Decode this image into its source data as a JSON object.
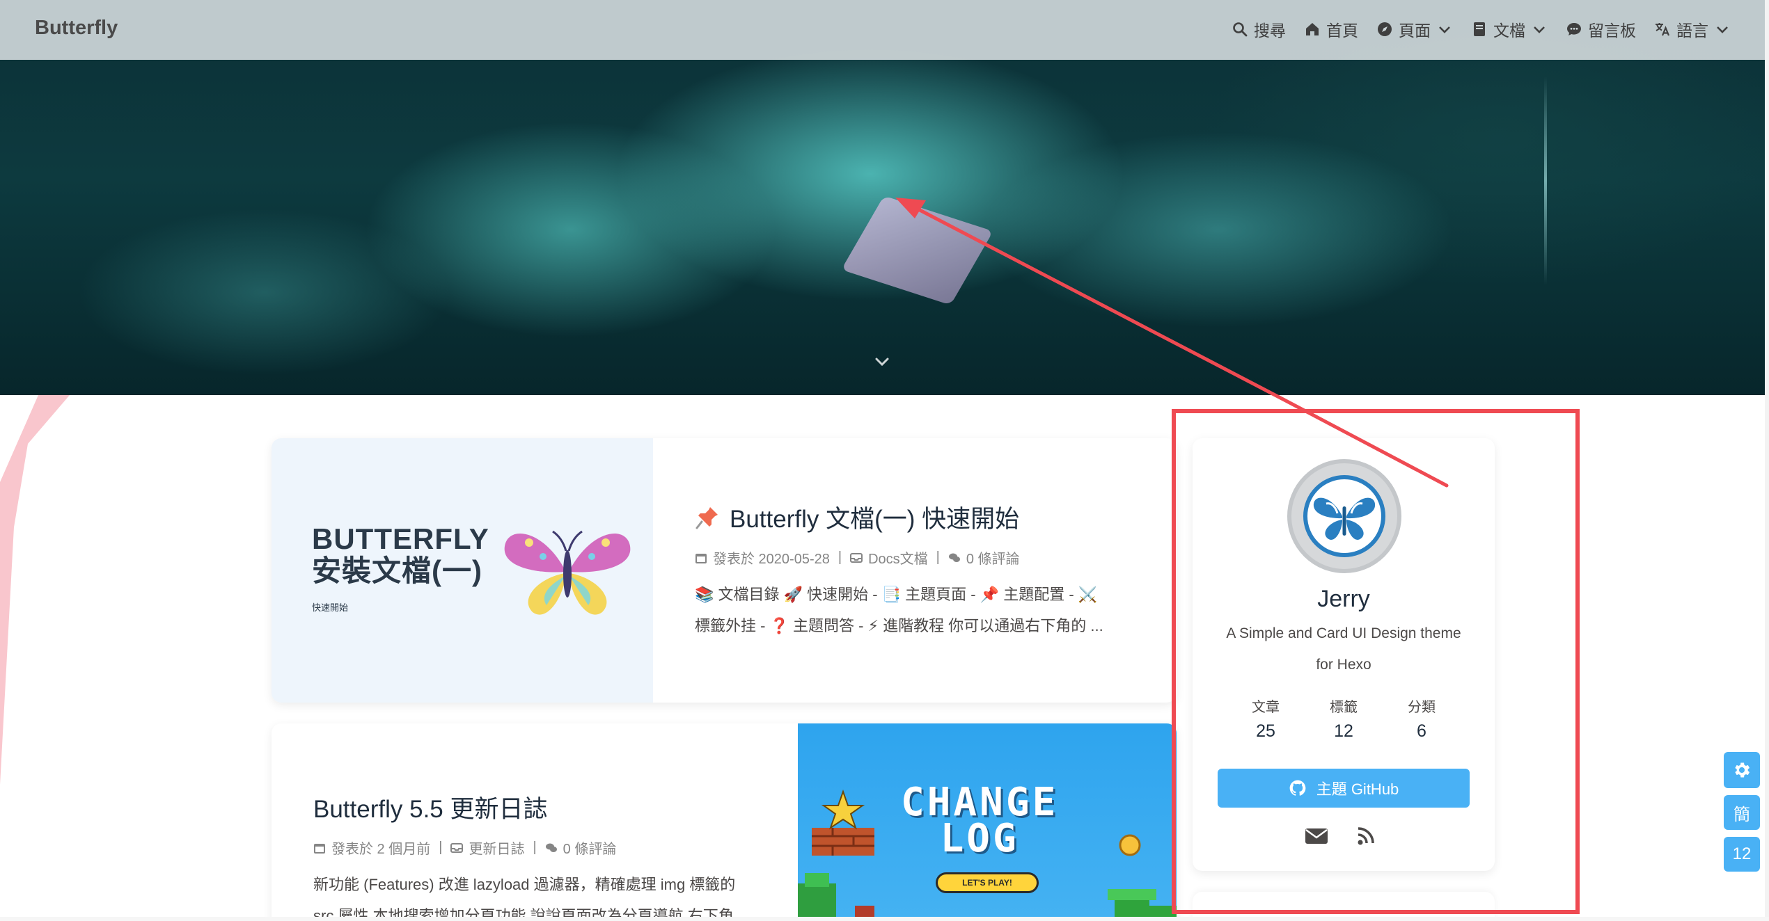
{
  "nav": {
    "site_name": "Butterfly",
    "menu": [
      {
        "label": "搜尋",
        "icon": "search-icon"
      },
      {
        "label": "首頁",
        "icon": "home-icon"
      },
      {
        "label": "頁面",
        "icon": "compass-icon",
        "dropdown": true
      },
      {
        "label": "文檔",
        "icon": "book-icon",
        "dropdown": true
      },
      {
        "label": "留言板",
        "icon": "comment-icon"
      },
      {
        "label": "語言",
        "icon": "language-icon",
        "dropdown": true
      }
    ]
  },
  "hero": {
    "scroll_down_icon": "chevron-down-icon"
  },
  "posts": [
    {
      "title": "Butterfly 文檔(一) 快速開始",
      "pinned": true,
      "date": "發表於 2020-05-28",
      "category": "Docs文檔",
      "comments": "0 條評論",
      "excerpt_line1": "📚 文檔目錄 🚀 快速開始 - 📑 主題頁面 - 📌 主題配置 - ⚔️",
      "excerpt_line2": "標籤外挂 - ❓ 主題問答 - ⚡ 進階教程 你可以通過右下角的 ...",
      "cover_title_line1": "BUTTERFLY",
      "cover_title_line2": "安裝文檔(一)",
      "cover_subtitle": "快速開始"
    },
    {
      "title": "Butterfly 5.5 更新日誌",
      "pinned": false,
      "date": "發表於 2 個月前",
      "category": "更新日誌",
      "comments": "0 條評論",
      "excerpt_line1": "新功能 (Features) 改進 lazyload 過濾器，精確處理 img 標籤的",
      "excerpt_line2": "src 屬性 本地搜索增加分頁功能 說說頁面改為分頁導航 右下角...",
      "cover_title_line1": "CHANGE",
      "cover_title_line2": "LOG",
      "cover_button": "LET'S PLAY!"
    }
  ],
  "author": {
    "name": "Jerry",
    "description": "A Simple and Card UI Design theme for Hexo",
    "stats": [
      {
        "label": "文章",
        "value": "25"
      },
      {
        "label": "標籤",
        "value": "12"
      },
      {
        "label": "分類",
        "value": "6"
      }
    ],
    "github_button": "主題 GitHub",
    "social_icons": [
      "email-icon",
      "rss-icon"
    ]
  },
  "rightside": {
    "settings_icon": "gear-icon",
    "translate_label": "簡",
    "counter": "12"
  },
  "colors": {
    "accent": "#49b1f5",
    "annotation": "#ef4a52",
    "nav_bg": "#cdd6d8"
  }
}
